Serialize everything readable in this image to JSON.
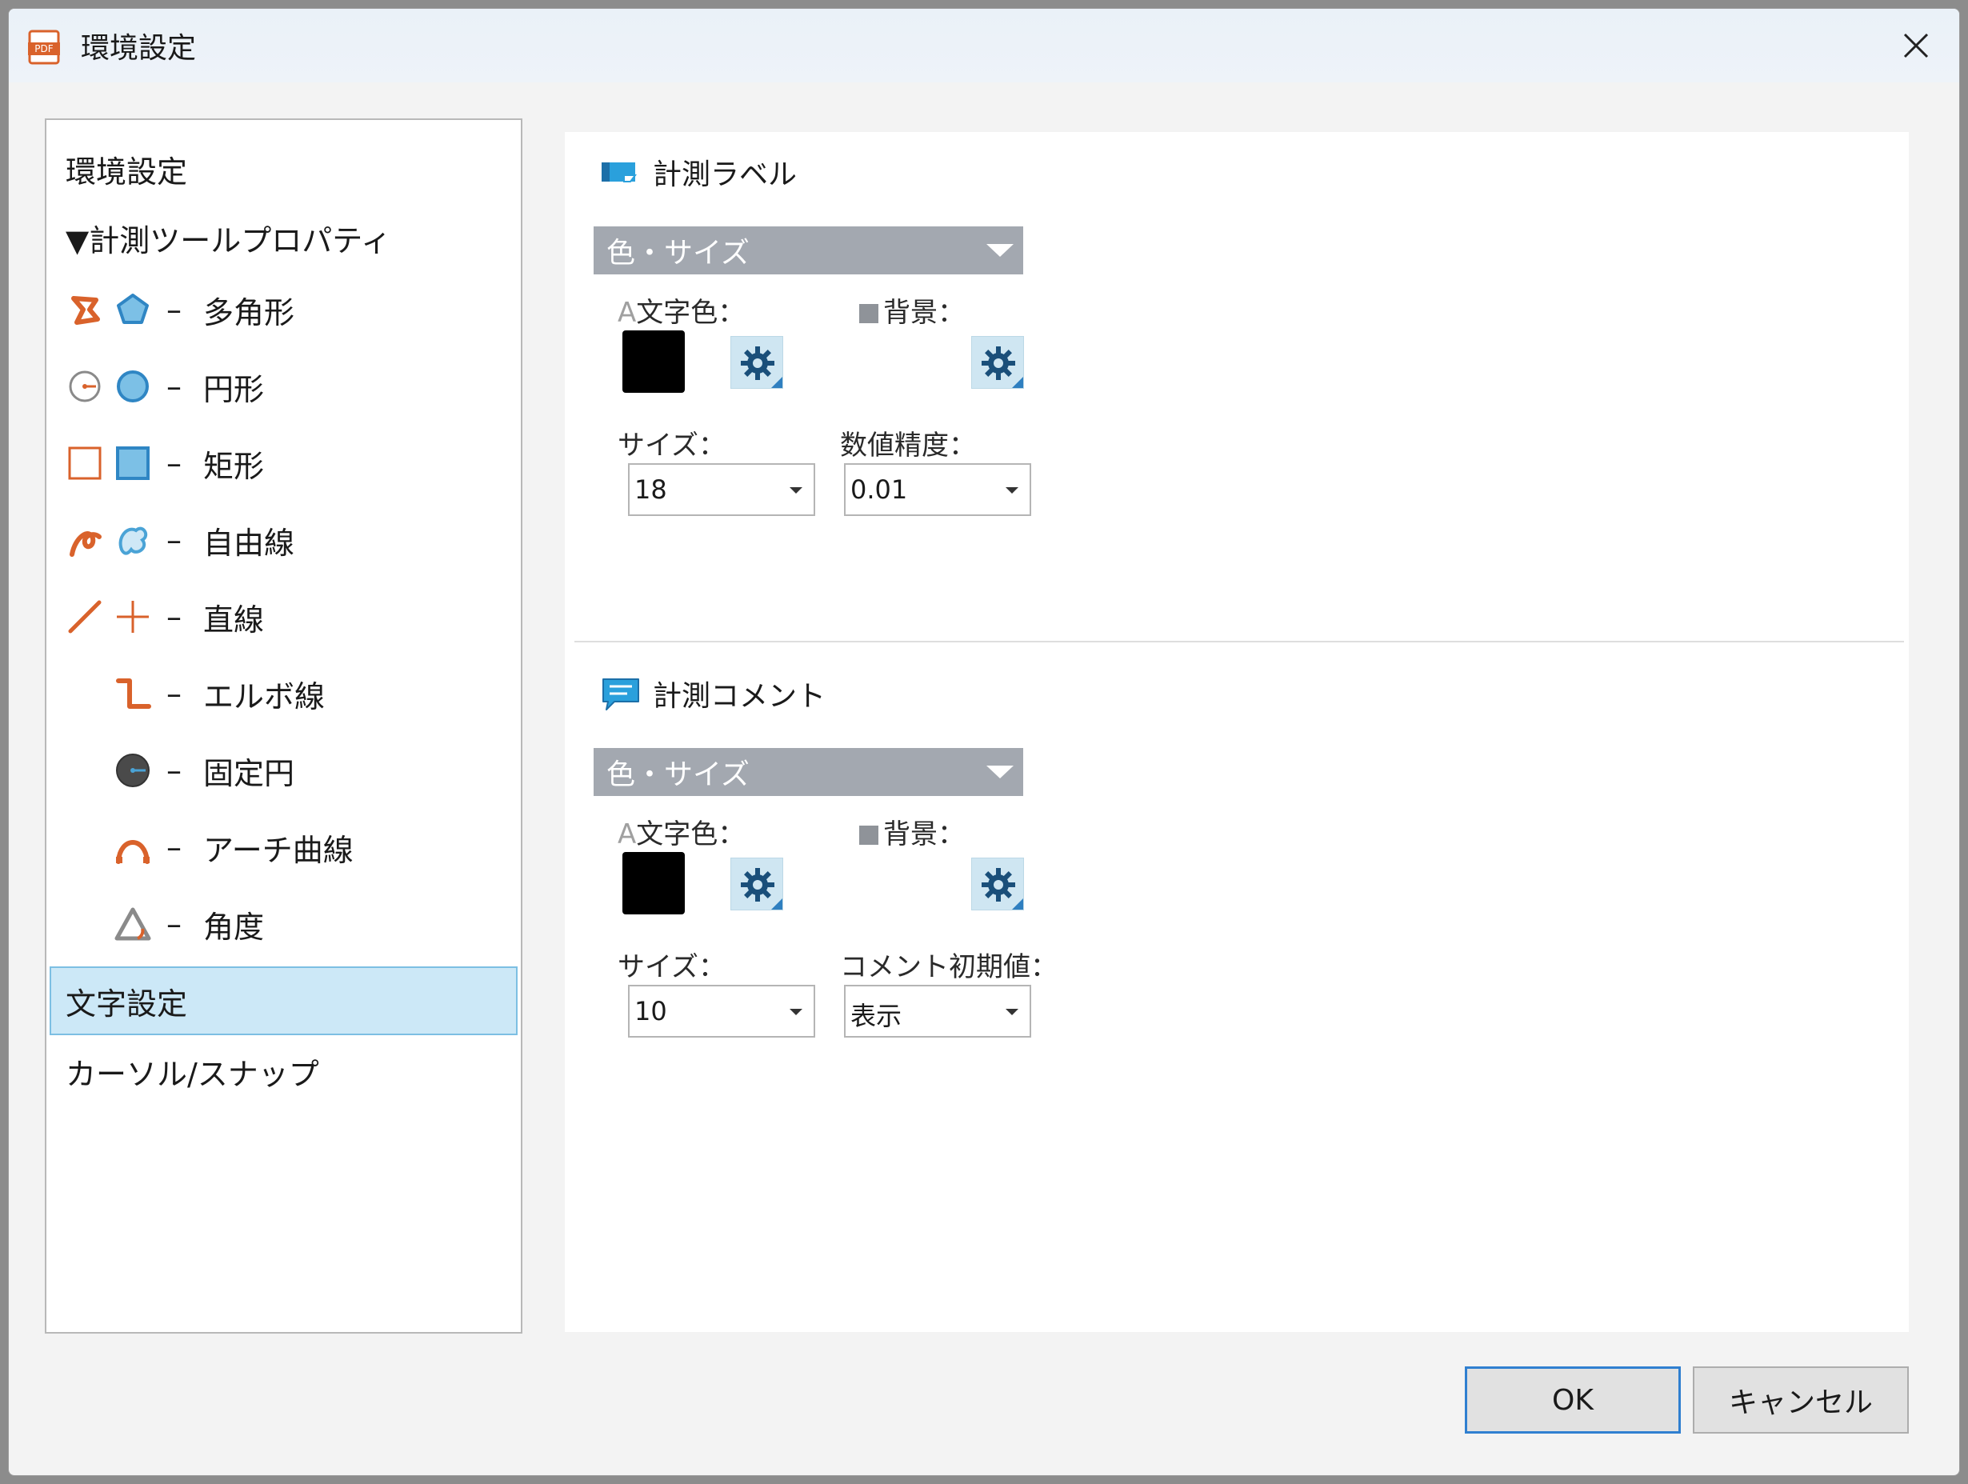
{
  "window": {
    "title": "環境設定",
    "icon": "pdf-app-icon",
    "close_icon": "close-icon"
  },
  "nav": {
    "items": [
      {
        "label": "環境設定"
      },
      {
        "label": "▼計測ツールプロパティ"
      },
      {
        "label": "多角形",
        "icons": [
          "polygon-orange-icon",
          "polygon-blue-icon"
        ]
      },
      {
        "label": "円形",
        "icons": [
          "circle-radius-icon",
          "circle-blue-icon"
        ]
      },
      {
        "label": "矩形",
        "icons": [
          "rect-orange-icon",
          "rect-blue-icon"
        ]
      },
      {
        "label": "自由線",
        "icons": [
          "freeline-orange-icon",
          "freeline-blue-icon"
        ]
      },
      {
        "label": "直線",
        "icons": [
          "line-orange-icon",
          "cross-orange-icon"
        ]
      },
      {
        "label": "エルボ線",
        "icons": [
          "elbow-line-icon"
        ]
      },
      {
        "label": "固定円",
        "icons": [
          "fixed-circle-icon"
        ]
      },
      {
        "label": "アーチ曲線",
        "icons": [
          "arch-curve-icon"
        ]
      },
      {
        "label": "角度",
        "icons": [
          "angle-icon"
        ]
      },
      {
        "label": "文字設定",
        "selected": true
      },
      {
        "label": "カーソル/スナップ"
      }
    ],
    "dash": "–"
  },
  "sections": {
    "label": {
      "title": "計測ラベル",
      "icon": "measure-label-icon",
      "group": "色・サイズ",
      "text_color_label_a": "A",
      "text_color_label": "文字色：",
      "bg_label": "背景：",
      "text_color": "#000000",
      "size_label": "サイズ：",
      "size_value": "18",
      "precision_label": "数値精度：",
      "precision_value": "0.01"
    },
    "comment": {
      "title": "計測コメント",
      "icon": "measure-comment-icon",
      "group": "色・サイズ",
      "text_color_label_a": "A",
      "text_color_label": "文字色：",
      "bg_label": "背景：",
      "text_color": "#000000",
      "size_label": "サイズ：",
      "size_value": "10",
      "initial_label": "コメント初期値：",
      "initial_value": "表示"
    }
  },
  "buttons": {
    "ok": "OK",
    "cancel": "キャンセル"
  },
  "colors": {
    "accent_orange": "#d9622b",
    "accent_blue": "#4aa3d6",
    "selected_bg": "#cce8f7",
    "group_bar": "#a3a8b0"
  }
}
